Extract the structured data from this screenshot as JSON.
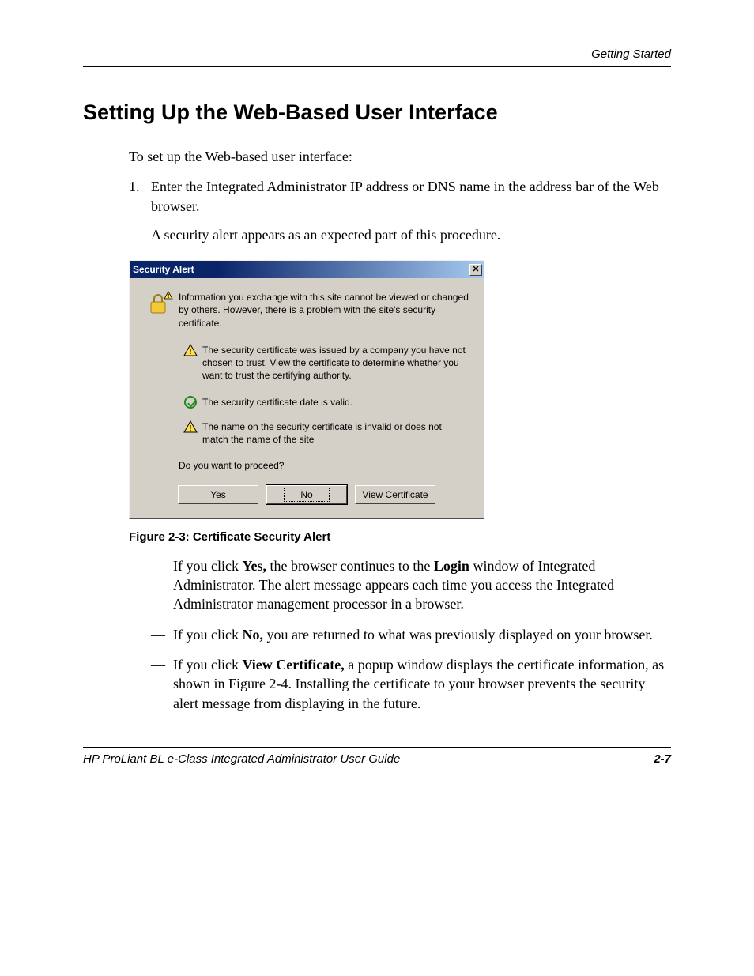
{
  "header": {
    "section": "Getting Started"
  },
  "title": "Setting Up the Web-Based User Interface",
  "intro": "To set up the Web-based user interface:",
  "step": {
    "num": "1.",
    "text": "Enter the Integrated Administrator IP address or DNS name in the address bar of the Web browser.",
    "note": "A security alert appears as an expected part of this procedure."
  },
  "dialog": {
    "title": "Security Alert",
    "close": "✕",
    "main_text": "Information you exchange with this site cannot be viewed or changed by others. However, there is a problem with the site's security certificate.",
    "item1": "The security certificate was issued by a company you have not chosen to trust. View the certificate to determine whether you want to trust the certifying authority.",
    "item2": "The security certificate date is valid.",
    "item3": "The name on the security certificate is invalid or does not match the name of the site",
    "proceed": "Do you want to proceed?",
    "btn_yes_u": "Y",
    "btn_yes_rest": "es",
    "btn_no_u": "N",
    "btn_no_rest": "o",
    "btn_view_u": "V",
    "btn_view_rest": "iew Certificate"
  },
  "figure_caption": "Figure 2-3:  Certificate Security Alert",
  "bullets": {
    "b1_pre": "If you click ",
    "b1_bold": "Yes,",
    "b1_mid": " the browser continues to the ",
    "b1_bold2": "Login",
    "b1_post": " window of Integrated Administrator. The alert message appears each time you access the Integrated Administrator management processor in a browser.",
    "b2_pre": "If you click ",
    "b2_bold": "No,",
    "b2_post": " you are returned to what was previously displayed on your browser.",
    "b3_pre": "If you click ",
    "b3_bold": "View Certificate,",
    "b3_post": " a popup window displays the certificate information, as shown in Figure 2-4. Installing the certificate to your browser prevents the security alert message from displaying in the future."
  },
  "footer": {
    "title": "HP ProLiant BL e-Class Integrated Administrator User Guide",
    "page": "2-7"
  }
}
